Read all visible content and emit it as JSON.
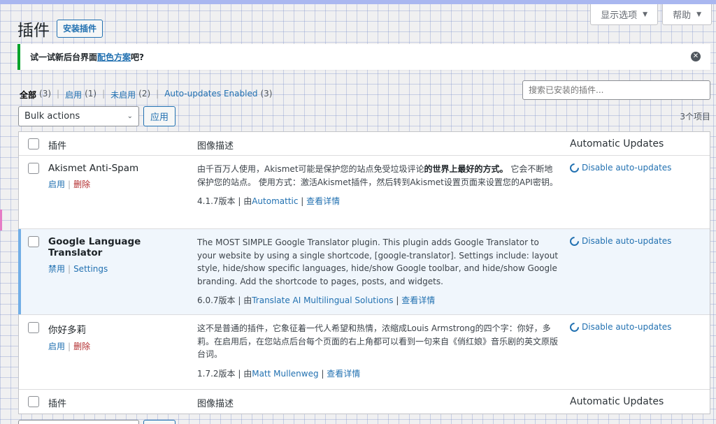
{
  "screen_options": {
    "display_label": "显示选项",
    "help_label": "帮助"
  },
  "header": {
    "title": "插件",
    "add_button": "安装插件"
  },
  "notice": {
    "prefix": "试一试新后台界面",
    "link": "配色方案",
    "suffix": "吧?"
  },
  "filters": {
    "all_label": "全部",
    "all_count": "(3)",
    "active_label": "启用",
    "active_count": "(1)",
    "inactive_label": "未启用",
    "inactive_count": "(2)",
    "auto_label": "Auto-updates Enabled",
    "auto_count": "(3)"
  },
  "search": {
    "placeholder": "搜索已安装的插件..."
  },
  "bulk": {
    "selected": "Bulk actions",
    "apply_label": "应用"
  },
  "item_count": "3个项目",
  "table": {
    "col_plugin": "插件",
    "col_desc": "图像描述",
    "col_updates": "Automatic Updates",
    "rows": [
      {
        "name": "Akismet Anti-Spam",
        "action1": "启用",
        "action2": "删除",
        "desc_a": "由千百万人使用，Akismet可能是保护您的站点免受垃圾评论",
        "desc_b": "的世界上最好的方式。",
        "desc_c": " 它会不断地保护您的站点。 使用方式：激活Akismet插件，然后转到Akismet设置页面来设置您的API密钥。",
        "version": "4.1.7版本 | 由",
        "author": "Automattic",
        "details": "查看详情",
        "update_link": "Disable auto-updates"
      },
      {
        "name": "Google Language Translator",
        "action1": "禁用",
        "action2": "Settings",
        "desc": "The MOST SIMPLE Google Translator plugin. This plugin adds Google Translator to your website by using a single shortcode, [google-translator]. Settings include: layout style, hide/show specific languages, hide/show Google toolbar, and hide/show Google branding. Add the shortcode to pages, posts, and widgets.",
        "version": "6.0.7版本 | 由",
        "author": "Translate AI Multilingual Solutions",
        "details": "查看详情",
        "update_link": "Disable auto-updates"
      },
      {
        "name": "你好多莉",
        "action1": "启用",
        "action2": "删除",
        "desc": "这不是普通的插件，它象征着一代人希望和热情，浓缩成Louis Armstrong的四个字：你好，多莉。在启用后，在您站点后台每个页面的右上角都可以看到一句来自《俏红娘》音乐剧的英文原版台词。",
        "version": "1.7.2版本 | 由",
        "author": "Matt Mullenweg",
        "details": "查看详情",
        "update_link": "Disable auto-updates"
      }
    ]
  }
}
